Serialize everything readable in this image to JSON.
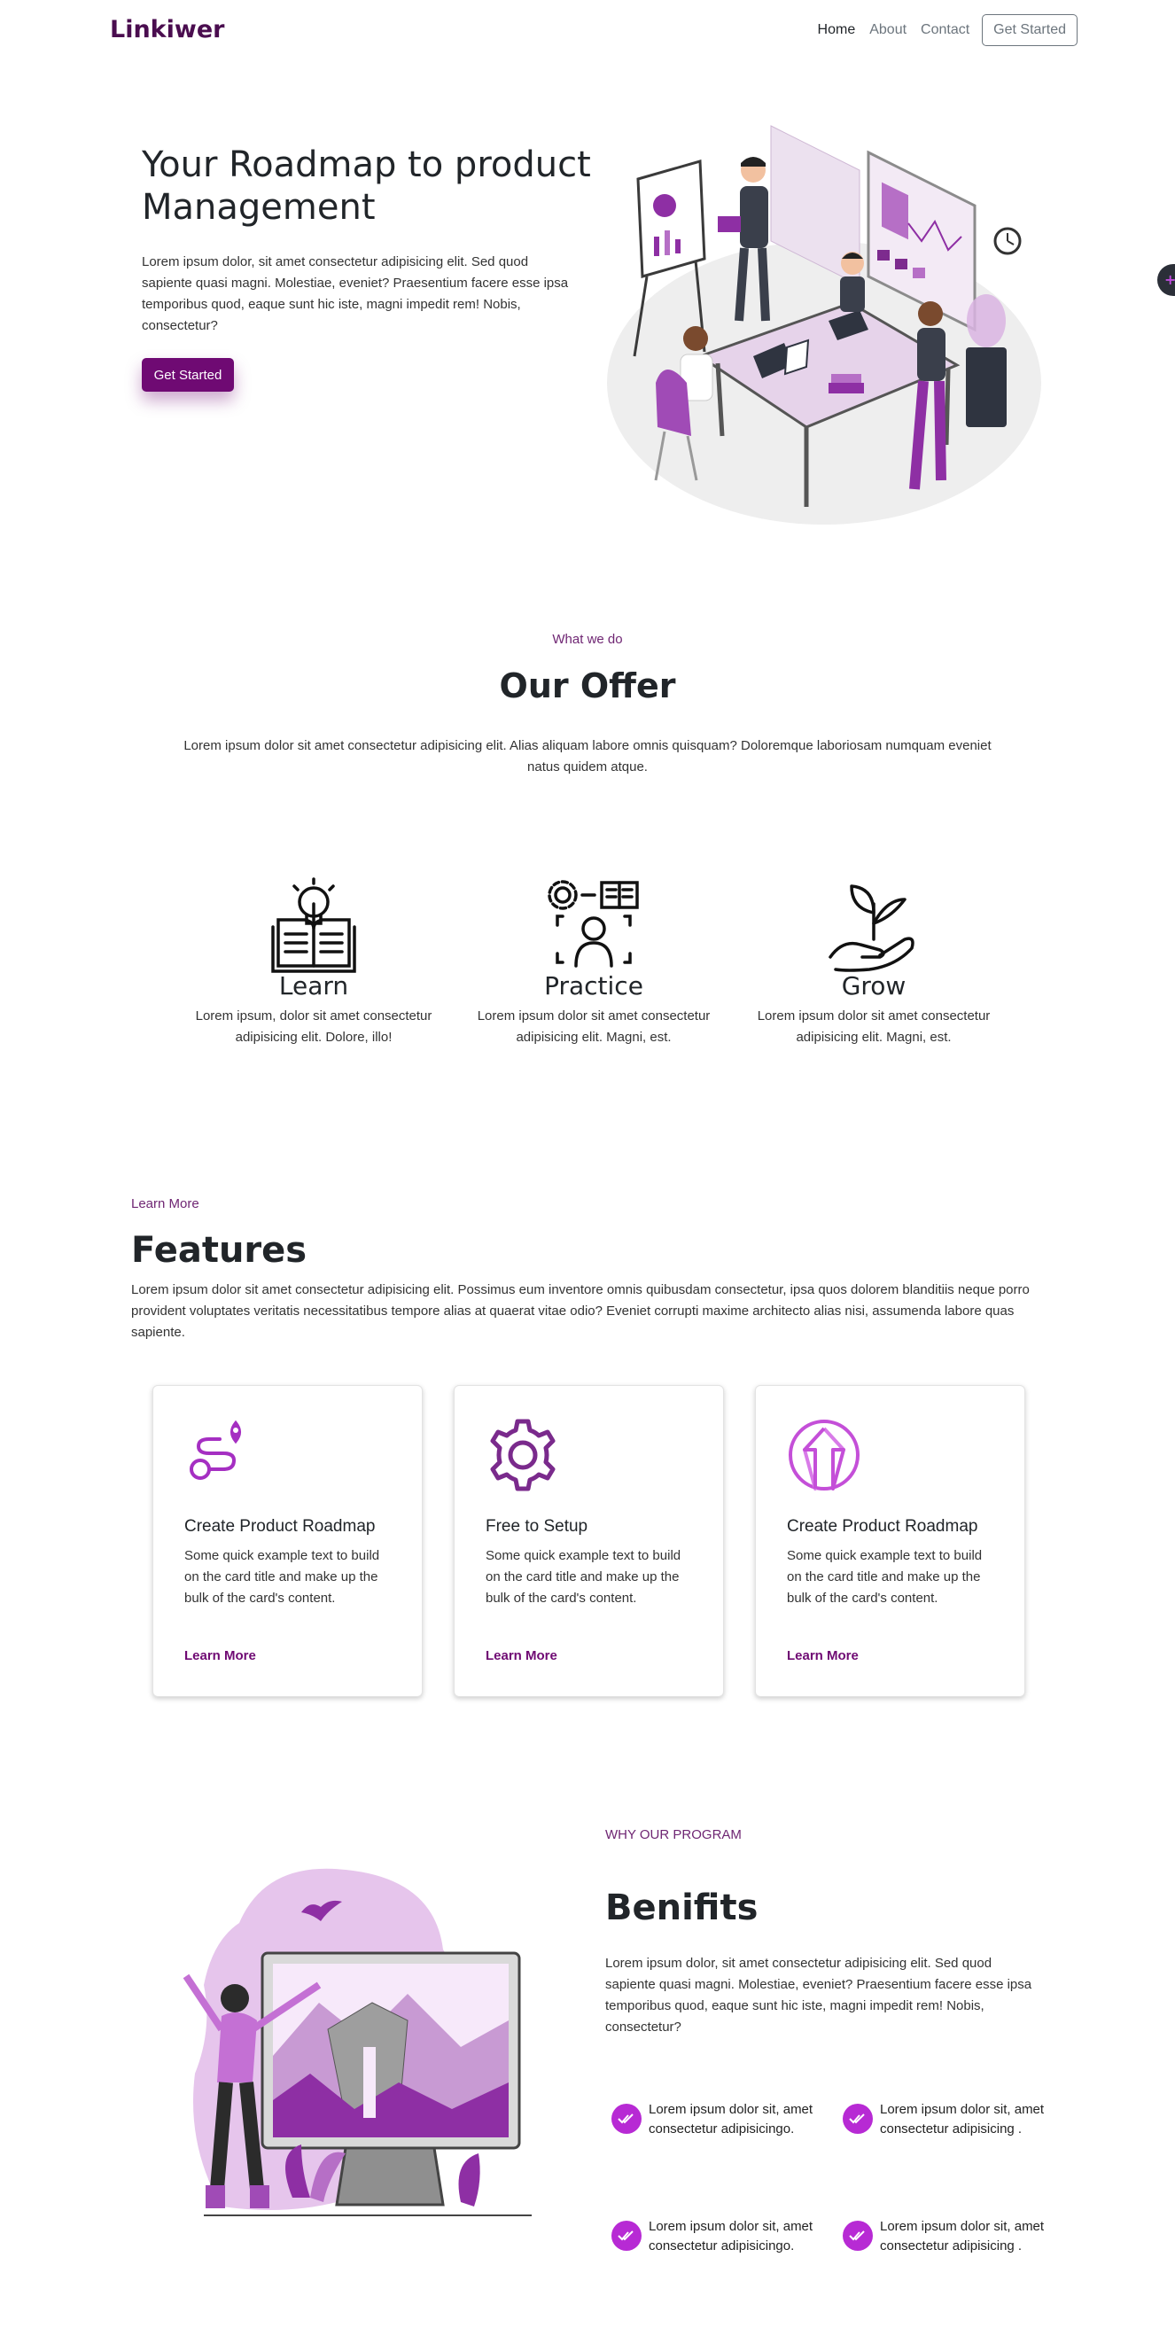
{
  "nav": {
    "brand": "Linkiwer",
    "links": [
      "Home",
      "About",
      "Contact"
    ],
    "cta": "Get Started"
  },
  "side_tab_icon": "plus-icon",
  "hero": {
    "title": "Your Roadmap to product Management",
    "text": "Lorem ipsum dolor, sit amet consectetur adipisicing elit. Sed quod sapiente quasi magni. Molestiae, eveniet? Praesentium facere esse ipsa temporibus quod, eaque sunt hic iste, magni impedit rem! Nobis, consectetur?",
    "button": "Get Started"
  },
  "offer": {
    "label": "What we do",
    "title": "Our Offer",
    "text": "Lorem ipsum dolor sit amet consectetur adipisicing elit. Alias aliquam labore omnis quisquam? Doloremque laboriosam numquam eveniet natus quidem atque.",
    "items": [
      {
        "icon": "book-lightbulb-icon",
        "title": "Learn",
        "text": "Lorem ipsum, dolor sit amet consectetur adipisicing elit. Dolore, illo!"
      },
      {
        "icon": "gear-person-book-icon",
        "title": "Practice",
        "text": "Lorem ipsum dolor sit amet consectetur adipisicing elit. Magni, est."
      },
      {
        "icon": "hand-plant-icon",
        "title": "Grow",
        "text": "Lorem ipsum dolor sit amet consectetur adipisicing elit. Magni, est."
      }
    ]
  },
  "features": {
    "label": "Learn More",
    "title": "Features",
    "text": "Lorem ipsum dolor sit amet consectetur adipisicing elit. Possimus eum inventore omnis quibusdam consectetur, ipsa quos dolorem blanditiis neque porro provident voluptates veritatis necessitatibus tempore alias at quaerat vitae odio? Eveniet corrupti maxime architecto alias nisi, assumenda labore quas sapiente.",
    "cards": [
      {
        "icon": "route-icon",
        "title": "Create Product Roadmap",
        "text": "Some quick example text to build on the card title and make up the bulk of the card's content.",
        "link": "Learn More"
      },
      {
        "icon": "gear-icon",
        "title": "Free to Setup",
        "text": "Some quick example text to build on the card title and make up the bulk of the card's content.",
        "link": "Learn More"
      },
      {
        "icon": "arrow-up-circle-icon",
        "title": "Create Product Roadmap",
        "text": "Some quick example text to build on the card title and make up the bulk of the card's content.",
        "link": "Learn More"
      }
    ]
  },
  "benefits": {
    "label": "WHY OUR PROGRAM",
    "title": "Benifits",
    "text": "Lorem ipsum dolor, sit amet consectetur adipisicing elit. Sed quod sapiente quasi magni. Molestiae, eveniet? Praesentium facere esse ipsa temporibus quod, eaque sunt hic iste, magni impedit rem! Nobis, consectetur?",
    "items": [
      "Lorem ipsum dolor sit, amet consectetur adipisicingo.",
      "Lorem ipsum dolor sit, amet consectetur adipisicing .",
      "Lorem ipsum dolor sit, amet consectetur adipisicingo.",
      "Lorem ipsum dolor sit, amet consectetur adipisicing ."
    ]
  },
  "colors": {
    "brand": "#4a0d4f",
    "accent": "#6f0a73",
    "check": "#b72ad4"
  }
}
